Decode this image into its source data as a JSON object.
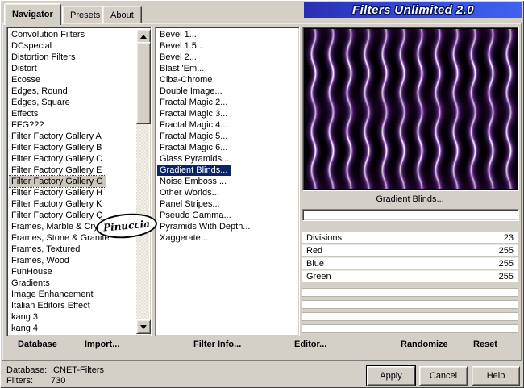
{
  "window_title": "Filters Unlimited 2.0",
  "tabs": [
    {
      "label": "Navigator",
      "active": true
    },
    {
      "label": "Presets",
      "active": false
    },
    {
      "label": "About",
      "active": false
    }
  ],
  "category_list": {
    "selected": "Filter Factory Gallery G",
    "items": [
      "Convolution Filters",
      "DCspecial",
      "Distortion Filters",
      "Distort",
      "Ecosse",
      "Edges, Round",
      "Edges, Square",
      "Effects",
      "FFG???",
      "Filter Factory Gallery A",
      "Filter Factory Gallery B",
      "Filter Factory Gallery C",
      "Filter Factory Gallery E",
      "Filter Factory Gallery G",
      "Filter Factory Gallery H",
      "Filter Factory Gallery K",
      "Filter Factory Gallery Q",
      "Frames, Marble & Crystal",
      "Frames, Stone & Granite",
      "Frames, Textured",
      "Frames, Wood",
      "FunHouse",
      "Gradients",
      "Image Enhancement",
      "Italian Editors Effect",
      "kang 3",
      "kang 4"
    ]
  },
  "filter_list": {
    "selected": "Gradient Blinds...",
    "items": [
      "Bevel 1...",
      "Bevel 1.5...",
      "Bevel 2...",
      "Blast 'Em...",
      "Ciba-Chrome",
      "Double Image...",
      "Fractal Magic 2...",
      "Fractal Magic 3...",
      "Fractal Magic 4...",
      "Fractal Magic 5...",
      "Fractal Magic 6...",
      "Glass Pyramids...",
      "Gradient Blinds...",
      "Noise Emboss ...",
      "Other Worlds...",
      "Panel Stripes...",
      "Pseudo Gamma...",
      "Pyramids With Depth...",
      "Xaggerate..."
    ]
  },
  "preview": {
    "caption": "Gradient Blinds...",
    "progress_percent": 0
  },
  "parameters": {
    "rows": [
      {
        "name": "Divisions",
        "value": "23"
      },
      {
        "name": "Red",
        "value": "255"
      },
      {
        "name": "Blue",
        "value": "255"
      },
      {
        "name": "Green",
        "value": "255"
      }
    ],
    "empty_rows": 4
  },
  "toolbar": {
    "database": "Database",
    "import": "Import...",
    "filter_info": "Filter Info...",
    "editor": "Editor...",
    "randomize": "Randomize",
    "reset": "Reset"
  },
  "status": {
    "database_label": "Database:",
    "database_value": "ICNET-Filters",
    "filters_label": "Filters:",
    "filters_value": "730"
  },
  "action_buttons": {
    "apply": "Apply",
    "cancel": "Cancel",
    "help": "Help"
  },
  "watermark": "Pinuccia",
  "colors": {
    "chrome": "#d4d0c8",
    "selection": "#0a246a",
    "banner_left": "#2a2fb2",
    "banner_right": "#3f62f0"
  }
}
